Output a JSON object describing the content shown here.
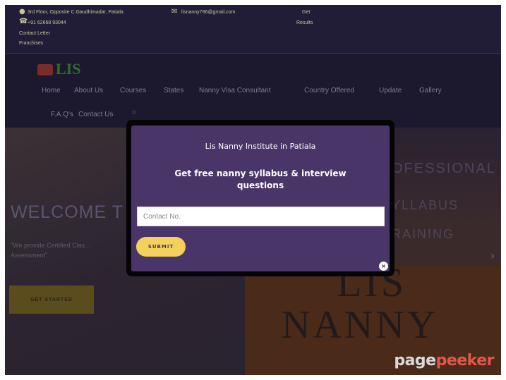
{
  "topbar": {
    "address": "3rd Floor, Opposite C.Gaudhimadar, Patiala",
    "email": "lisnanny786@gmail.com",
    "phone": "+91 62668 93044",
    "contact_letter": "Contact Letter",
    "franchises": "Franchises",
    "get_results_1": "Get",
    "get_results_2": "Results"
  },
  "logo": {
    "text": "LIS"
  },
  "nav": {
    "items": [
      "Home",
      "About Us",
      "Courses",
      "States",
      "Nanny Visa Consultant",
      "Country Offered",
      "Update",
      "Gallery"
    ],
    "items_row2": [
      "F.A.Q's",
      "Contact Us"
    ]
  },
  "hero": {
    "welcome": "WELCOME T",
    "subtitle": "\"We provide Certified Clas... Assessment\"",
    "get_started": "GET STARTED",
    "banner_top": "OFESSIONAL N",
    "banner_line1": "YLLABUS",
    "banner_line2": "RAINING",
    "big_word1": "LIS",
    "big_word2": "NANNY",
    "arrow": "›"
  },
  "popup": {
    "title": "Lis Nanny Institute in Patiala",
    "subtitle": "Get free nanny syllabus & interview questions",
    "input_placeholder": "Contact No.",
    "input_value": "",
    "submit_label": "SUBMIT",
    "close_label": "×"
  },
  "watermark": {
    "part1": "page",
    "part2": "peeker"
  },
  "colors": {
    "popup_bg": "#4a3568",
    "submit_bg": "#f3d15a",
    "watermark_accent": "#e2574c"
  }
}
